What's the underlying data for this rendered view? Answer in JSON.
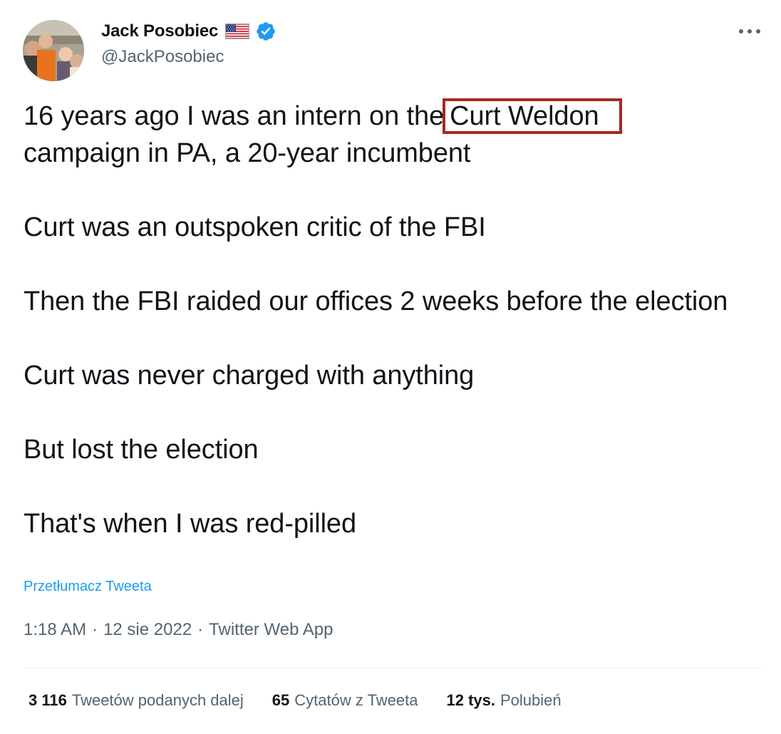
{
  "author": {
    "display_name": "Jack Posobiec",
    "handle": "@JackPosobiec",
    "flag_icon": "us-flag-icon",
    "verified_icon": "verified-badge-icon"
  },
  "more_icon": "more-options-icon",
  "tweet": {
    "line1_before": "16 years ago I was an intern on the",
    "line1_highlight": "Curt Weldon",
    "line1_after": "campaign in PA, a 20-year incumbent",
    "p2": "Curt was an outspoken critic of the FBI",
    "p3": "Then the FBI raided our offices 2 weeks before the election",
    "p4": "Curt was never charged with anything",
    "p5": "But lost the election",
    "p6": "That's when I was red-pilled"
  },
  "translate_label": "Przetłumacz Tweeta",
  "meta": {
    "time": "1:18 AM",
    "sep": "·",
    "date": "12 sie 2022",
    "source": "Twitter Web App"
  },
  "stats": [
    {
      "num": "3 116",
      "label": "Tweetów podanych dalej"
    },
    {
      "num": "65",
      "label": "Cytatów z Tweeta"
    },
    {
      "num": "12 tys.",
      "label": "Polubień"
    }
  ],
  "colors": {
    "text": "#0f1419",
    "secondary": "#536471",
    "link": "#1d9bf0",
    "verified": "#1d9bf0",
    "highlight_box": "#a32a1e"
  }
}
